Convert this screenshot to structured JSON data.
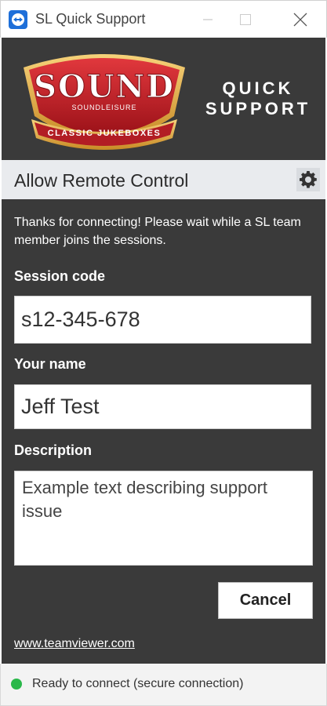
{
  "window": {
    "title": "SL Quick Support",
    "icon": "teamviewer-icon",
    "controls": [
      "minimize-icon",
      "maximize-icon",
      "close-icon"
    ]
  },
  "banner": {
    "logo": {
      "main_text": "SOUND",
      "sub_text": "SOUNDLEISURE",
      "ribbon_text": "CLASSIC JUKEBOXES"
    },
    "product_line1": "QUICK",
    "product_line2": "SUPPORT"
  },
  "section": {
    "title": "Allow Remote Control",
    "settings_icon": "gear-icon"
  },
  "form": {
    "intro": "Thanks for connecting! Please wait while a SL team member joins the sessions.",
    "session_code_label": "Session code",
    "session_code_value": "s12-345-678",
    "name_label": "Your name",
    "name_value": "Jeff Test",
    "description_label": "Description",
    "description_value": "Example text describing support issue",
    "cancel_label": "Cancel"
  },
  "footer": {
    "link_text": "www.teamviewer.com"
  },
  "status": {
    "text": "Ready to connect (secure connection)",
    "indicator_color": "#2ab84a"
  },
  "colors": {
    "panel": "#3a3a3a",
    "section_bar": "#e9ebee",
    "logo_red": "#c8202a",
    "logo_gold": "#e3a93c"
  }
}
